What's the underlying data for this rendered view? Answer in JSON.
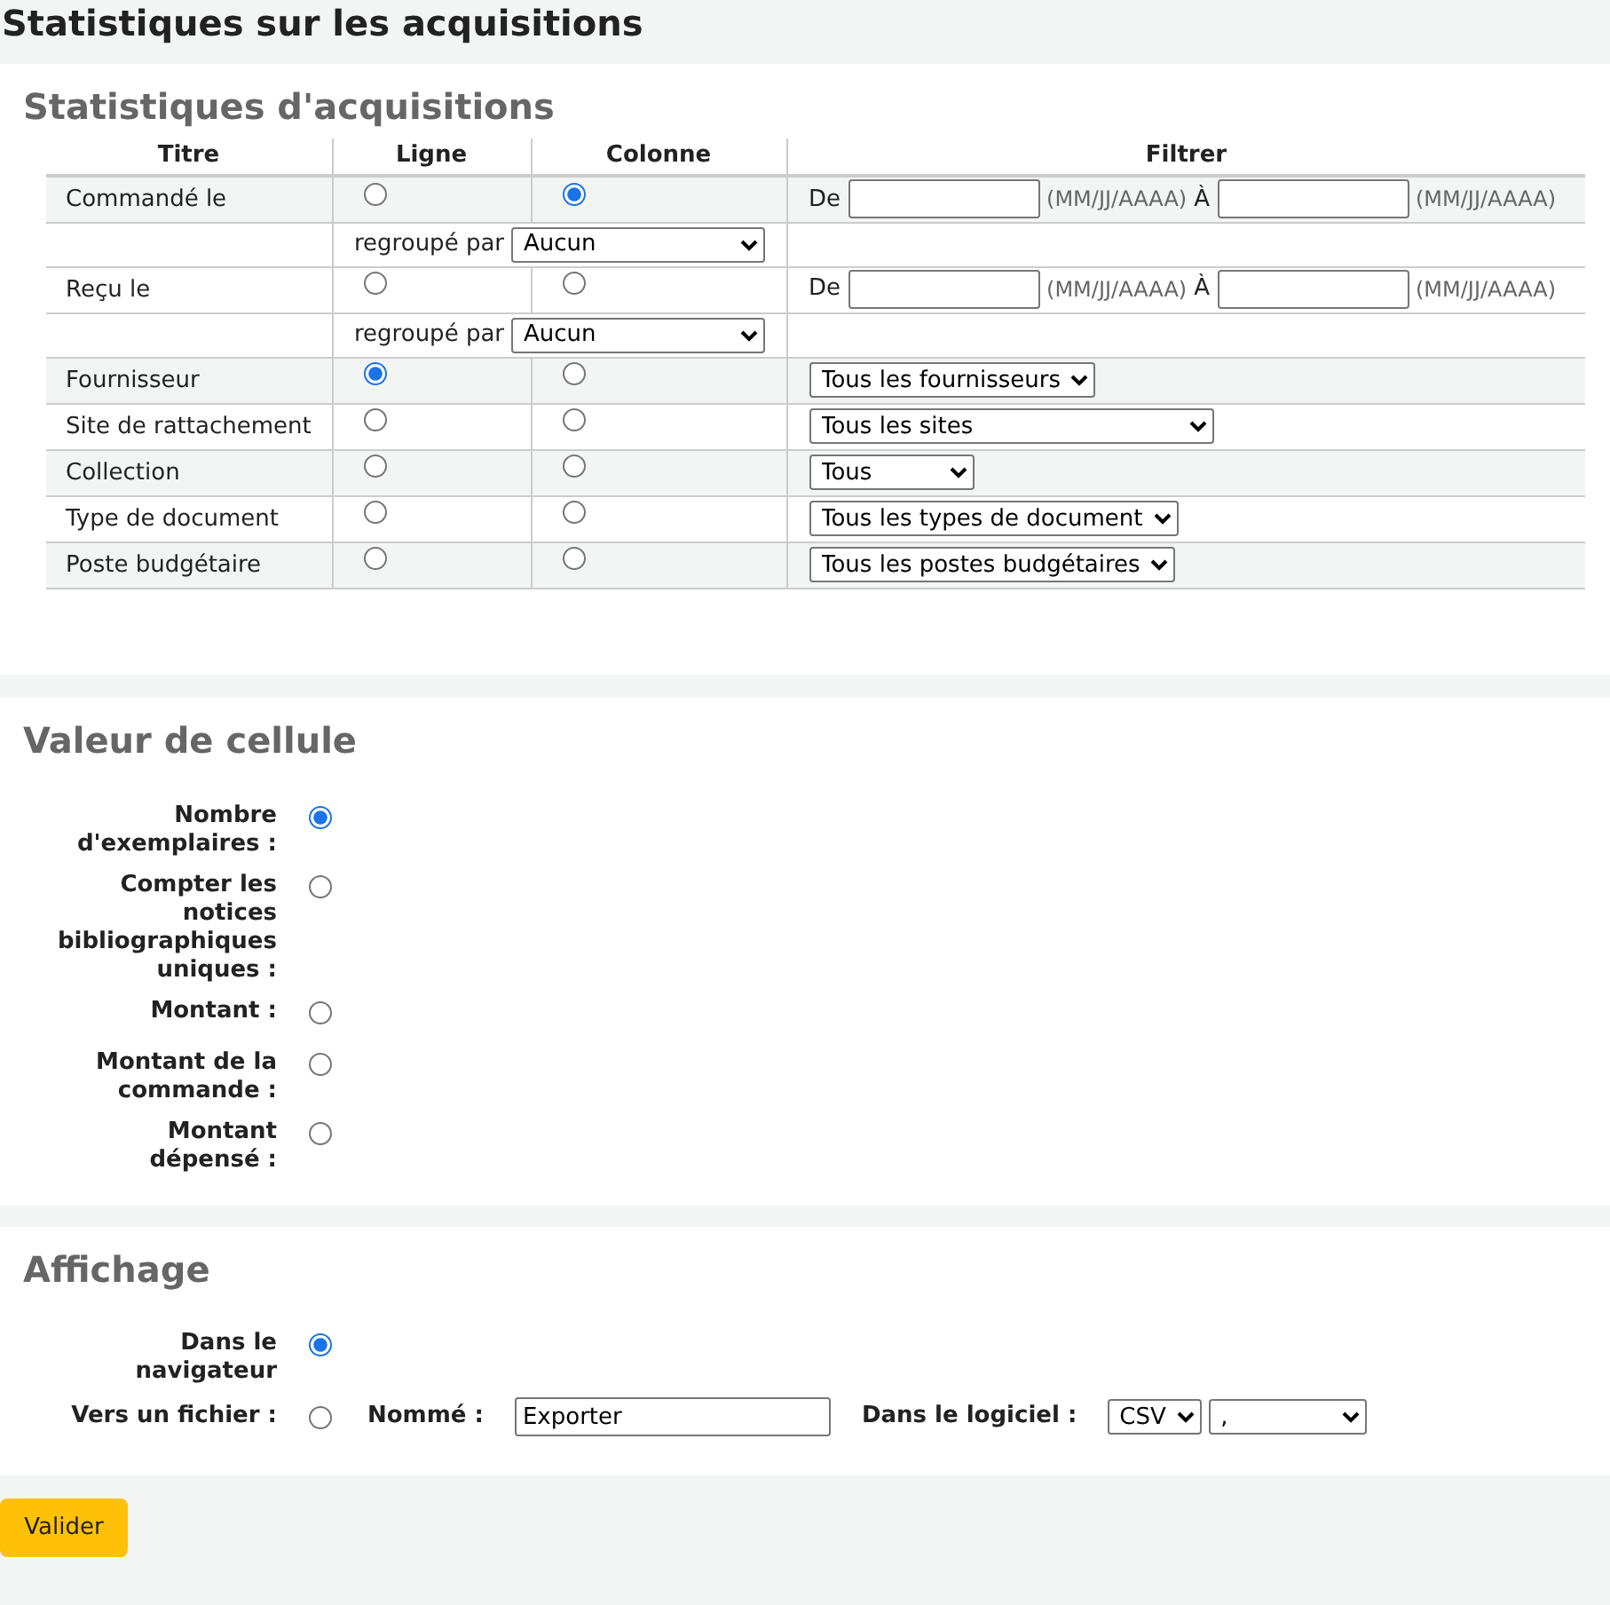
{
  "page_title": "Statistiques sur les acquisitions",
  "stats": {
    "heading": "Statistiques d'acquisitions",
    "columns": [
      "Titre",
      "Ligne",
      "Colonne",
      "Filtrer"
    ],
    "rows": [
      {
        "kind": "date",
        "title": "Commandé le",
        "line_selected": false,
        "column_selected": true,
        "from_label": "De",
        "from_hint": "(MM/JJ/AAAA)",
        "to_label": "À",
        "to_hint": "(MM/JJ/AAAA)",
        "group_label": "regroupé par",
        "group_value": "Aucun"
      },
      {
        "kind": "date",
        "title": "Reçu le",
        "line_selected": false,
        "column_selected": false,
        "from_label": "De",
        "from_hint": "(MM/JJ/AAAA)",
        "to_label": "À",
        "to_hint": "(MM/JJ/AAAA)",
        "group_label": "regroupé par",
        "group_value": "Aucun"
      },
      {
        "kind": "select",
        "title": "Fournisseur",
        "line_selected": true,
        "column_selected": false,
        "filter": "Tous les fournisseurs"
      },
      {
        "kind": "select",
        "title": "Site de rattachement",
        "line_selected": false,
        "column_selected": false,
        "filter": "Tous les sites"
      },
      {
        "kind": "select",
        "title": "Collection",
        "line_selected": false,
        "column_selected": false,
        "filter": "Tous"
      },
      {
        "kind": "select",
        "title": "Type de document",
        "line_selected": false,
        "column_selected": false,
        "filter": "Tous les types de document"
      },
      {
        "kind": "select",
        "title": "Poste budgétaire",
        "line_selected": false,
        "column_selected": false,
        "filter": "Tous les postes budgétaires"
      }
    ]
  },
  "cell_value": {
    "heading": "Valeur de cellule",
    "options": [
      {
        "label": "Nombre d'exemplaires :",
        "selected": true
      },
      {
        "label": "Compter les notices bibliographiques uniques :",
        "selected": false
      },
      {
        "label": "Montant :",
        "selected": false
      },
      {
        "label": "Montant de la commande :",
        "selected": false
      },
      {
        "label": "Montant dépensé :",
        "selected": false
      }
    ]
  },
  "display": {
    "heading": "Affichage",
    "browser": {
      "label": "Dans le navigateur",
      "selected": true
    },
    "file": {
      "label": "Vers un fichier :",
      "selected": false,
      "name_label": "Nommé :",
      "name_value": "Exporter",
      "software_label": "Dans le logiciel :",
      "format": "CSV",
      "separator": ","
    }
  },
  "submit": "Valider"
}
